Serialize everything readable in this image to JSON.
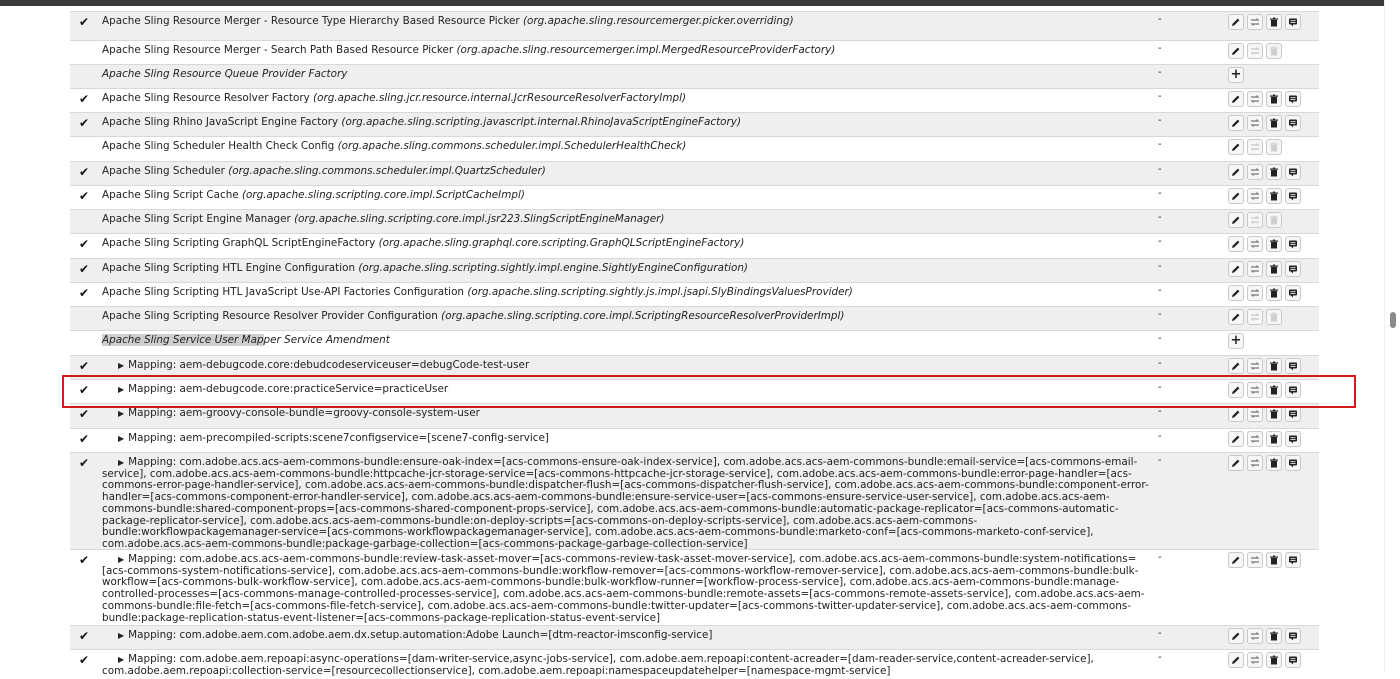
{
  "rows": [
    {
      "checked": true,
      "factory": false,
      "name": "Apache Sling Resource Merger - Resource Type Hierarchy Based Resource Picker",
      "pid": "(org.apache.sling.resourcemerger.picker.overriding)",
      "bundle": "-",
      "actions": [
        "edit",
        "unbind",
        "delete",
        "info"
      ]
    },
    {
      "checked": false,
      "factory": false,
      "name": "Apache Sling Resource Merger - Search Path Based Resource Picker",
      "pid": "(org.apache.sling.resourcemerger.impl.MergedResourceProviderFactory)",
      "bundle": "-",
      "actions": [
        "edit",
        "unbind-disabled",
        "delete-disabled"
      ]
    },
    {
      "checked": false,
      "factory": true,
      "name": "Apache Sling Resource Queue Provider Factory",
      "pid": "",
      "bundle": "-",
      "actions": [
        "add"
      ]
    },
    {
      "checked": true,
      "factory": false,
      "name": "Apache Sling Resource Resolver Factory",
      "pid": "(org.apache.sling.jcr.resource.internal.JcrResourceResolverFactoryImpl)",
      "bundle": "-",
      "actions": [
        "edit",
        "unbind",
        "delete",
        "info"
      ]
    },
    {
      "checked": true,
      "factory": false,
      "name": "Apache Sling Rhino JavaScript Engine Factory",
      "pid": "(org.apache.sling.scripting.javascript.internal.RhinoJavaScriptEngineFactory)",
      "bundle": "-",
      "actions": [
        "edit",
        "unbind",
        "delete",
        "info"
      ]
    },
    {
      "checked": false,
      "factory": false,
      "name": "Apache Sling Scheduler Health Check Config",
      "pid": "(org.apache.sling.commons.scheduler.impl.SchedulerHealthCheck)",
      "bundle": "-",
      "actions": [
        "edit",
        "unbind-disabled",
        "delete-disabled"
      ]
    },
    {
      "checked": true,
      "factory": false,
      "name": "Apache Sling Scheduler",
      "pid": "(org.apache.sling.commons.scheduler.impl.QuartzScheduler)",
      "bundle": "-",
      "actions": [
        "edit",
        "unbind",
        "delete",
        "info"
      ]
    },
    {
      "checked": true,
      "factory": false,
      "name": "Apache Sling Script Cache",
      "pid": "(org.apache.sling.scripting.core.impl.ScriptCacheImpl)",
      "bundle": "-",
      "actions": [
        "edit",
        "unbind",
        "delete",
        "info"
      ]
    },
    {
      "checked": false,
      "factory": false,
      "name": "Apache Sling Script Engine Manager",
      "pid": "(org.apache.sling.scripting.core.impl.jsr223.SlingScriptEngineManager)",
      "bundle": "-",
      "actions": [
        "edit",
        "unbind-disabled",
        "delete-disabled"
      ]
    },
    {
      "checked": true,
      "factory": false,
      "name": "Apache Sling Scripting GraphQL ScriptEngineFactory",
      "pid": "(org.apache.sling.graphql.core.scripting.GraphQLScriptEngineFactory)",
      "bundle": "-",
      "actions": [
        "edit",
        "unbind",
        "delete",
        "info"
      ]
    },
    {
      "checked": true,
      "factory": false,
      "name": "Apache Sling Scripting HTL Engine Configuration",
      "pid": "(org.apache.sling.scripting.sightly.impl.engine.SightlyEngineConfiguration)",
      "bundle": "-",
      "actions": [
        "edit",
        "unbind",
        "delete",
        "info"
      ]
    },
    {
      "checked": true,
      "factory": false,
      "name": "Apache Sling Scripting HTL JavaScript Use-API Factories Configuration",
      "pid": "(org.apache.sling.scripting.sightly.js.impl.jsapi.SlyBindingsValuesProvider)",
      "bundle": "-",
      "actions": [
        "edit",
        "unbind",
        "delete",
        "info"
      ]
    },
    {
      "checked": false,
      "factory": false,
      "name": "Apache Sling Scripting Resource Resolver Provider Configuration",
      "pid": "(org.apache.sling.scripting.core.impl.ScriptingResourceResolverProviderImpl)",
      "bundle": "-",
      "actions": [
        "edit",
        "unbind-disabled",
        "delete-disabled"
      ]
    },
    {
      "checked": false,
      "factory": true,
      "name": "Apache Sling Service User Mapper Service Amendment",
      "pid": "",
      "bundle": "-",
      "actions": [
        "add"
      ]
    },
    {
      "checked": true,
      "mapping": true,
      "name": "Mapping: aem-debugcode.core:debudcodeserviceuser=debugCode-test-user",
      "bundle": "-",
      "actions": [
        "edit",
        "unbind",
        "delete",
        "info"
      ]
    },
    {
      "checked": true,
      "mapping": true,
      "name": "Mapping: aem-debugcode.core:practiceService=practiceUser",
      "bundle": "-",
      "actions": [
        "edit",
        "unbind",
        "delete",
        "info"
      ]
    },
    {
      "checked": true,
      "mapping": true,
      "name": "Mapping: aem-groovy-console-bundle=groovy-console-system-user",
      "bundle": "-",
      "actions": [
        "edit",
        "unbind",
        "delete",
        "info"
      ]
    },
    {
      "checked": true,
      "mapping": true,
      "name": "Mapping: aem-precompiled-scripts:scene7configservice=[scene7-config-service]",
      "bundle": "-",
      "actions": [
        "edit",
        "unbind",
        "delete",
        "info"
      ]
    },
    {
      "checked": true,
      "mapping": true,
      "name": "Mapping: com.adobe.acs.acs-aem-commons-bundle:ensure-oak-index=[acs-commons-ensure-oak-index-service], com.adobe.acs.acs-aem-commons-bundle:email-service=[acs-commons-email-service], com.adobe.acs.acs-aem-commons-bundle:httpcache-jcr-storage-service=[acs-commons-httpcache-jcr-storage-service], com.adobe.acs.acs-aem-commons-bundle:error-page-handler=[acs-commons-error-page-handler-service], com.adobe.acs.acs-aem-commons-bundle:dispatcher-flush=[acs-commons-dispatcher-flush-service], com.adobe.acs.acs-aem-commons-bundle:component-error-handler=[acs-commons-component-error-handler-service], com.adobe.acs.acs-aem-commons-bundle:ensure-service-user=[acs-commons-ensure-service-user-service], com.adobe.acs.acs-aem-commons-bundle:shared-component-props=[acs-commons-shared-component-props-service], com.adobe.acs.acs-aem-commons-bundle:automatic-package-replicator=[acs-commons-automatic-package-replicator-service], com.adobe.acs.acs-aem-commons-bundle:on-deploy-scripts=[acs-commons-on-deploy-scripts-service], com.adobe.acs.acs-aem-commons-bundle:workflowpackagemanager-service=[acs-commons-workflowpackagemanager-service], com.adobe.acs.acs-aem-commons-bundle:marketo-conf=[acs-commons-marketo-conf-service], com.adobe.acs.acs-aem-commons-bundle:package-garbage-collection=[acs-commons-package-garbage-collection-service]",
      "bundle": "-",
      "actions": [
        "edit",
        "unbind",
        "delete",
        "info"
      ]
    },
    {
      "checked": true,
      "mapping": true,
      "name": "Mapping: com.adobe.acs.acs-aem-commons-bundle:review-task-asset-mover=[acs-commons-review-task-asset-mover-service], com.adobe.acs.acs-aem-commons-bundle:system-notifications=[acs-commons-system-notifications-service], com.adobe.acs.acs-aem-commons-bundle:workflow-remover=[acs-commons-workflow-remover-service], com.adobe.acs.acs-aem-commons-bundle:bulk-workflow=[acs-commons-bulk-workflow-service], com.adobe.acs.acs-aem-commons-bundle:bulk-workflow-runner=[workflow-process-service], com.adobe.acs.acs-aem-commons-bundle:manage-controlled-processes=[acs-commons-manage-controlled-processes-service], com.adobe.acs.acs-aem-commons-bundle:remote-assets=[acs-commons-remote-assets-service], com.adobe.acs.acs-aem-commons-bundle:file-fetch=[acs-commons-file-fetch-service], com.adobe.acs.acs-aem-commons-bundle:twitter-updater=[acs-commons-twitter-updater-service], com.adobe.acs.acs-aem-commons-bundle:package-replication-status-event-listener=[acs-commons-package-replication-status-event-service]",
      "bundle": "-",
      "actions": [
        "edit",
        "unbind",
        "delete",
        "info"
      ]
    },
    {
      "checked": true,
      "mapping": true,
      "name": "Mapping: com.adobe.aem.com.adobe.aem.dx.setup.automation:Adobe Launch=[dtm-reactor-imsconfig-service]",
      "bundle": "-",
      "actions": [
        "edit",
        "unbind",
        "delete",
        "info"
      ]
    },
    {
      "checked": true,
      "mapping": true,
      "name": "Mapping: com.adobe.aem.repoapi:async-operations=[dam-writer-service,async-jobs-service], com.adobe.aem.repoapi:content-acreader=[dam-reader-service,content-acreader-service], com.adobe.aem.repoapi:collection-service=[resourcecollectionservice], com.adobe.aem.repoapi:namespaceupdatehelper=[namespace-mgmt-service]",
      "bundle": "-",
      "actions": [
        "edit",
        "unbind",
        "delete",
        "info"
      ]
    }
  ]
}
